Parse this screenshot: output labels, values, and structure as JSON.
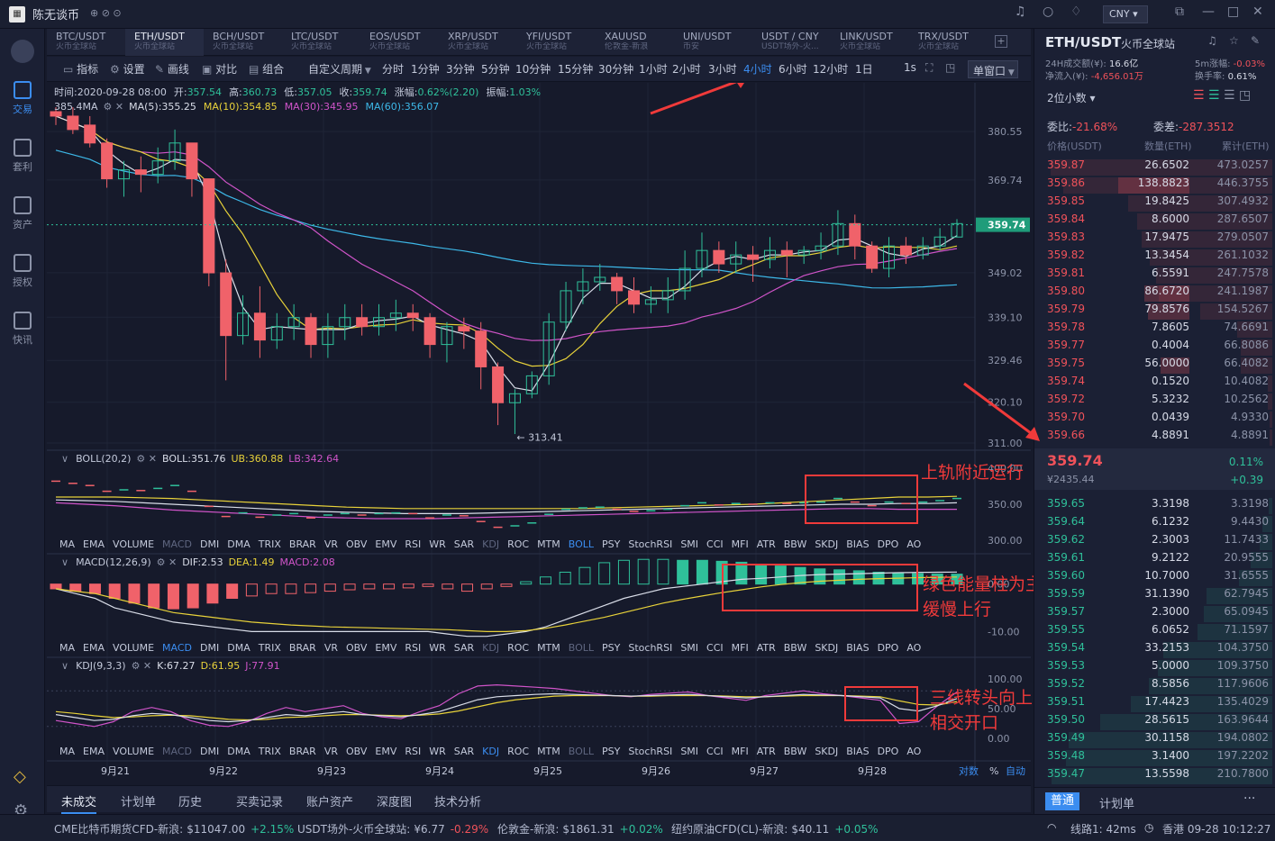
{
  "app": {
    "title": "陈无谈币",
    "currency": "CNY"
  },
  "tabs": [
    {
      "pair": "BTC/USDT",
      "exchange": "火币全球站"
    },
    {
      "pair": "ETH/USDT",
      "exchange": "火币全球站"
    },
    {
      "pair": "BCH/USDT",
      "exchange": "火币全球站"
    },
    {
      "pair": "LTC/USDT",
      "exchange": "火币全球站"
    },
    {
      "pair": "EOS/USDT",
      "exchange": "火币全球站"
    },
    {
      "pair": "XRP/USDT",
      "exchange": "火币全球站"
    },
    {
      "pair": "YFI/USDT",
      "exchange": "火币全球站"
    },
    {
      "pair": "XAUUSD",
      "exchange": "伦敦金-新浪"
    },
    {
      "pair": "UNI/USDT",
      "exchange": "币安"
    },
    {
      "pair": "USDT / CNY",
      "exchange": "USDT场外-火..."
    },
    {
      "pair": "LINK/USDT",
      "exchange": "火币全球站"
    },
    {
      "pair": "TRX/USDT",
      "exchange": "火币全球站"
    }
  ],
  "toolbar": {
    "indicator": "指标",
    "settings": "设置",
    "draw": "画线",
    "compare": "对比",
    "combo": "组合",
    "custom_period": "自定义周期",
    "periods": [
      "分时",
      "1分钟",
      "3分钟",
      "5分钟",
      "10分钟",
      "15分钟",
      "30分钟",
      "1小时",
      "2小时",
      "3小时",
      "4小时",
      "6小时",
      "12小时",
      "1日"
    ],
    "active_period": "4小时",
    "interval": "1s",
    "window": "单窗口"
  },
  "info_bar": {
    "time_label": "时间:",
    "time": "2020-09-28 08:00",
    "open_label": "开:",
    "open": "357.54",
    "high_label": "高:",
    "high": "360.73",
    "low_label": "低:",
    "low": "357.05",
    "close_label": "收:",
    "close": "359.74",
    "change_label": "涨幅:",
    "change": "0.62%(2.20)",
    "amp_label": "振幅:",
    "amp": "1.03%"
  },
  "ma_bar": {
    "marker": "385.4",
    "label": "MA",
    "ma5": "MA(5):355.25",
    "ma10": "MA(10):354.85",
    "ma30": "MA(30):345.95",
    "ma60": "MA(60):356.07"
  },
  "boll_bar": {
    "title": "BOLL(20,2)",
    "mid": "BOLL:351.76",
    "ub": "UB:360.88",
    "lb": "LB:342.64"
  },
  "macd_bar": {
    "title": "MACD(12,26,9)",
    "dif": "DIF:2.53",
    "dea": "DEA:1.49",
    "macd": "MACD:2.08"
  },
  "kdj_bar": {
    "title": "KDJ(9,3,3)",
    "k": "K:67.27",
    "d": "D:61.95",
    "j": "J:77.91"
  },
  "indicator_list": [
    "MA",
    "EMA",
    "VOLUME",
    "MACD",
    "DMI",
    "DMA",
    "TRIX",
    "BRAR",
    "VR",
    "OBV",
    "EMV",
    "RSI",
    "WR",
    "SAR",
    "KDJ",
    "ROC",
    "MTM",
    "BOLL",
    "PSY",
    "StochRSI",
    "SMI",
    "CCI",
    "MFI",
    "ATR",
    "BBW",
    "SKDJ",
    "BIAS",
    "DPO",
    "AO"
  ],
  "chart_data": {
    "type": "candlestick",
    "price_axis_ticks": [
      "380.55",
      "369.74",
      "359.74",
      "349.02",
      "339.10",
      "329.46",
      "320.10",
      "311.00"
    ],
    "last_price": "359.74",
    "low_marker": "← 313.41",
    "boll_ticks": [
      "400.00",
      "350.00",
      "300.00"
    ],
    "macd_ticks": [
      "0.00",
      "-10.00"
    ],
    "kdj_ticks": [
      "100.00",
      "50.00",
      "0.00"
    ],
    "dates": [
      "9月21",
      "9月22",
      "9月23",
      "9月24",
      "9月25",
      "9月26",
      "9月27",
      "9月28"
    ],
    "ohlc": [
      [
        385,
        384,
        386,
        382
      ],
      [
        384,
        381,
        386,
        380
      ],
      [
        382,
        378,
        384,
        377
      ],
      [
        378,
        370,
        379,
        368
      ],
      [
        370,
        372,
        374,
        366
      ],
      [
        372,
        371,
        375,
        367
      ],
      [
        371,
        374,
        377,
        369
      ],
      [
        374,
        378,
        381,
        372
      ],
      [
        378,
        370,
        378,
        366
      ],
      [
        370,
        349,
        370,
        346
      ],
      [
        349,
        335,
        352,
        325
      ],
      [
        335,
        340,
        344,
        333
      ],
      [
        340,
        334,
        346,
        330
      ],
      [
        334,
        337,
        340,
        332
      ],
      [
        337,
        339,
        342,
        334
      ],
      [
        339,
        333,
        340,
        330
      ],
      [
        333,
        337,
        340,
        330
      ],
      [
        337,
        339,
        342,
        334
      ],
      [
        339,
        337,
        342,
        335
      ],
      [
        337,
        339,
        342,
        335
      ],
      [
        339,
        340,
        343,
        336
      ],
      [
        340,
        339,
        342,
        336
      ],
      [
        339,
        333,
        340,
        330
      ],
      [
        333,
        337,
        338,
        329
      ],
      [
        337,
        336,
        339,
        332
      ],
      [
        336,
        328,
        338,
        323
      ],
      [
        328,
        320,
        329,
        315
      ],
      [
        320,
        322,
        323,
        313
      ],
      [
        322,
        326,
        327,
        321
      ],
      [
        326,
        338,
        340,
        324
      ],
      [
        338,
        345,
        347,
        336
      ],
      [
        345,
        347,
        350,
        342
      ],
      [
        347,
        348,
        351,
        345
      ],
      [
        348,
        345,
        349,
        342
      ],
      [
        345,
        342,
        348,
        340
      ],
      [
        342,
        343,
        346,
        340
      ],
      [
        343,
        345,
        348,
        340
      ],
      [
        345,
        350,
        354,
        343
      ],
      [
        350,
        354,
        358,
        348
      ],
      [
        354,
        351,
        356,
        349
      ],
      [
        351,
        353,
        356,
        349
      ],
      [
        353,
        352,
        355,
        347
      ],
      [
        352,
        354,
        357,
        350
      ],
      [
        354,
        353,
        356,
        348
      ],
      [
        353,
        354,
        355,
        351
      ],
      [
        354,
        355,
        358,
        352
      ],
      [
        355,
        360,
        363,
        353
      ],
      [
        360,
        355,
        362,
        352
      ],
      [
        355,
        350,
        356,
        349
      ],
      [
        350,
        355,
        357,
        348
      ],
      [
        355,
        353,
        357,
        351
      ],
      [
        353,
        355,
        357,
        352
      ],
      [
        355,
        357,
        359,
        354
      ],
      [
        357,
        360,
        361,
        357
      ]
    ],
    "boll": {
      "ub": [
        360,
        360,
        360,
        359,
        358,
        356,
        354,
        352,
        350,
        348,
        346,
        345,
        344,
        344,
        344,
        344,
        344,
        344,
        344,
        345,
        346,
        347,
        348,
        349,
        350,
        352,
        354,
        356,
        358,
        360,
        360,
        361
      ],
      "mid": [
        356,
        355,
        354,
        352,
        350,
        348,
        346,
        344,
        342,
        340,
        339,
        338,
        337,
        337,
        337,
        338,
        339,
        340,
        341,
        342,
        343,
        344,
        345,
        346,
        347,
        348,
        349,
        350,
        350,
        351,
        351,
        352
      ],
      "lb": [
        352,
        350,
        348,
        345,
        342,
        340,
        338,
        336,
        334,
        332,
        331,
        330,
        330,
        330,
        331,
        332,
        333,
        334,
        335,
        336,
        337,
        338,
        339,
        340,
        341,
        342,
        343,
        344,
        344,
        343,
        343,
        343
      ]
    },
    "macd": {
      "hist": [
        -1,
        -1.5,
        -2,
        -3,
        -4,
        -5,
        -5.2,
        -5,
        -4,
        -3,
        -2.5,
        -2,
        -2,
        -1.8,
        -1.5,
        -1.2,
        -1,
        -1,
        -0.8,
        -0.5,
        -1,
        -1.5,
        -1,
        -0.5,
        0.5,
        1.5,
        2.5,
        3.5,
        4.5,
        5,
        5.2,
        5.2,
        5,
        5,
        4.8,
        4.6,
        4.2,
        3.8,
        3.5,
        3.2,
        3,
        2.8,
        2.5,
        2.3,
        2.2,
        2.1,
        2.08
      ],
      "dif": [
        -1,
        -2,
        -3,
        -5,
        -6,
        -7,
        -8,
        -8.5,
        -9,
        -9.5,
        -10,
        -10,
        -10,
        -10,
        -10,
        -10,
        -10,
        -10,
        -10,
        -10,
        -10.5,
        -11,
        -11,
        -10.5,
        -10,
        -9,
        -7.5,
        -6,
        -4.5,
        -3,
        -2,
        -1,
        -0.5,
        0,
        0.5,
        1,
        1.2,
        1.5,
        1.8,
        2,
        2.1,
        2.2,
        2.3,
        2.4,
        2.45,
        2.5,
        2.53
      ],
      "dea": [
        -1,
        -1.5,
        -2,
        -3,
        -4,
        -5,
        -6,
        -6.5,
        -7,
        -7.5,
        -8,
        -8.3,
        -8.6,
        -8.8,
        -9,
        -9.1,
        -9.2,
        -9.3,
        -9.4,
        -9.5,
        -9.6,
        -9.8,
        -10,
        -10,
        -9.8,
        -9.3,
        -8.6,
        -7.8,
        -7,
        -6,
        -5,
        -4,
        -3.2,
        -2.5,
        -1.8,
        -1.2,
        -0.6,
        -0.1,
        0.3,
        0.6,
        0.8,
        1,
        1.15,
        1.25,
        1.35,
        1.42,
        1.49
      ]
    },
    "kdj": {
      "k": [
        40,
        35,
        30,
        32,
        38,
        42,
        40,
        35,
        30,
        28,
        30,
        35,
        40,
        38,
        42,
        45,
        40,
        38,
        36,
        40,
        45,
        55,
        65,
        70,
        72,
        74,
        75,
        74,
        73,
        72,
        71,
        72,
        73,
        74,
        72,
        70,
        68,
        70,
        72,
        74,
        73,
        72,
        70,
        68,
        50,
        46,
        55,
        67
      ],
      "d": [
        45,
        42,
        38,
        35,
        36,
        38,
        39,
        38,
        35,
        32,
        31,
        32,
        35,
        36,
        38,
        40,
        40,
        39,
        38,
        39,
        41,
        46,
        53,
        60,
        65,
        68,
        71,
        72,
        72,
        72,
        71,
        71,
        72,
        72,
        72,
        71,
        70,
        70,
        71,
        72,
        72,
        72,
        71,
        70,
        63,
        57,
        56,
        62
      ],
      "j": [
        30,
        25,
        20,
        28,
        45,
        52,
        45,
        30,
        22,
        20,
        28,
        42,
        52,
        45,
        50,
        55,
        42,
        36,
        33,
        45,
        55,
        75,
        88,
        90,
        88,
        86,
        84,
        80,
        76,
        72,
        70,
        74,
        76,
        78,
        72,
        68,
        64,
        72,
        76,
        80,
        75,
        72,
        68,
        64,
        25,
        28,
        55,
        78
      ]
    }
  },
  "annotations": [
    {
      "text": "上轨附近运行"
    },
    {
      "text": "绿色能量柱为主"
    },
    {
      "text": "缓慢上行"
    },
    {
      "text": "三线转头向上"
    },
    {
      "text": "相交开口"
    }
  ],
  "chart_footer": {
    "pair_label": "对数",
    "pct": "%",
    "auto": "自动"
  },
  "bottom_tabs": [
    "未成交",
    "计划单",
    "历史",
    "买卖记录",
    "账户资产",
    "深度图",
    "技术分析"
  ],
  "ticker": [
    {
      "name": "CME比特币期货CFD-新浪:",
      "price": "$11047.00",
      "change": "+2.15%",
      "dir": "up"
    },
    {
      "name": "USDT场外-火币全球站:",
      "price": "¥6.77",
      "change": "-0.29%",
      "dir": "dn"
    },
    {
      "name": "伦敦金-新浪:",
      "price": "$1861.31",
      "change": "+0.02%",
      "dir": "up"
    },
    {
      "name": "纽约原油CFD(CL)-新浪:",
      "price": "$40.11",
      "change": "+0.05%",
      "dir": "up"
    }
  ],
  "status": {
    "line": "线路1: 42ms",
    "clock": "香港 09-28 10:12:27"
  },
  "sidenav": [
    {
      "label": "交易",
      "active": true
    },
    {
      "label": "套利"
    },
    {
      "label": "资产"
    },
    {
      "label": "授权"
    },
    {
      "label": "快讯"
    }
  ],
  "right_panel": {
    "pair": "ETH/USDT",
    "exchange": "火币全球站",
    "vol_label": "24H成交额(¥):",
    "vol": "16.6亿",
    "chg5_label": "5m涨幅:",
    "chg5": "-0.03%",
    "inflow_label": "净流入(¥):",
    "inflow": "-4,656.01万",
    "turnover_label": "换手率:",
    "turnover": "0.61%",
    "decimals": "2位小数",
    "ratio_label": "委比:",
    "ratio": "-21.68%",
    "diff_label": "委差:",
    "diff": "-287.3512",
    "col_price": "价格(USDT)",
    "col_qty": "数量(ETH)",
    "col_total": "累计(ETH)",
    "asks": [
      [
        "359.87",
        "26.6502",
        "473.0257"
      ],
      [
        "359.86",
        "138.8823",
        "446.3755"
      ],
      [
        "359.85",
        "19.8425",
        "307.4932"
      ],
      [
        "359.84",
        "8.6000",
        "287.6507"
      ],
      [
        "359.83",
        "17.9475",
        "279.0507"
      ],
      [
        "359.82",
        "13.3454",
        "261.1032"
      ],
      [
        "359.81",
        "6.5591",
        "247.7578"
      ],
      [
        "359.80",
        "86.6720",
        "241.1987"
      ],
      [
        "359.79",
        "79.8576",
        "154.5267"
      ],
      [
        "359.78",
        "7.8605",
        "74.6691"
      ],
      [
        "359.77",
        "0.4004",
        "66.8086"
      ],
      [
        "359.75",
        "56.0000",
        "66.4082"
      ],
      [
        "359.74",
        "0.1520",
        "10.4082"
      ],
      [
        "359.72",
        "5.3232",
        "10.2562"
      ],
      [
        "359.70",
        "0.0439",
        "4.9330"
      ],
      [
        "359.66",
        "4.8891",
        "4.8891"
      ]
    ],
    "last": "359.74",
    "last_cny": "¥2435.44",
    "last_pct": "0.11%",
    "last_chg": "+0.39",
    "bids": [
      [
        "359.65",
        "3.3198",
        "3.3198"
      ],
      [
        "359.64",
        "6.1232",
        "9.4430"
      ],
      [
        "359.62",
        "2.3003",
        "11.7433"
      ],
      [
        "359.61",
        "9.2122",
        "20.9555"
      ],
      [
        "359.60",
        "10.7000",
        "31.6555"
      ],
      [
        "359.59",
        "31.1390",
        "62.7945"
      ],
      [
        "359.57",
        "2.3000",
        "65.0945"
      ],
      [
        "359.55",
        "6.0652",
        "71.1597"
      ],
      [
        "359.54",
        "33.2153",
        "104.3750"
      ],
      [
        "359.53",
        "5.0000",
        "109.3750"
      ],
      [
        "359.52",
        "8.5856",
        "117.9606"
      ],
      [
        "359.51",
        "17.4423",
        "135.4029"
      ],
      [
        "359.50",
        "28.5615",
        "163.9644"
      ],
      [
        "359.49",
        "30.1158",
        "194.0802"
      ],
      [
        "359.48",
        "3.1400",
        "197.2202"
      ],
      [
        "359.47",
        "13.5598",
        "210.7800"
      ]
    ],
    "tab_normal": "普通",
    "tab_plan": "计划单"
  }
}
